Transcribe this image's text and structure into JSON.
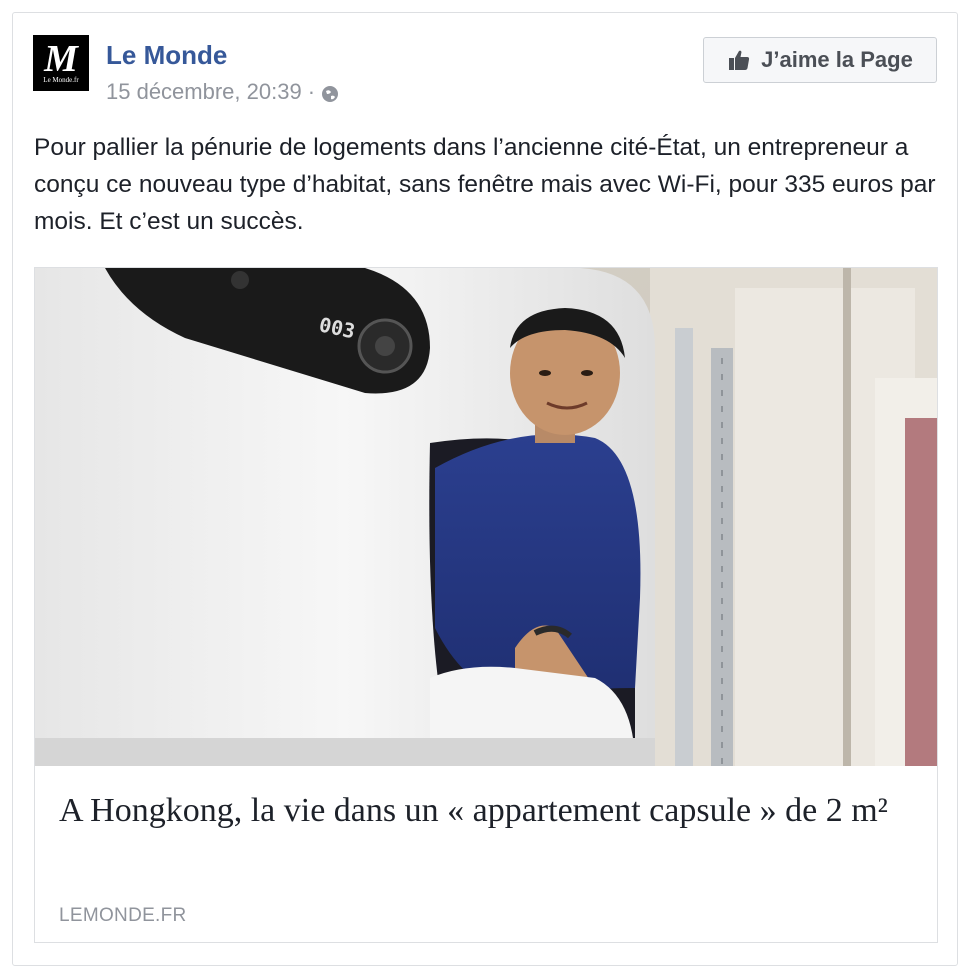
{
  "post": {
    "page_name": "Le Monde",
    "timestamp": "15 décembre, 20:39",
    "separator": "·",
    "privacy_icon": "globe-icon",
    "like_page_label": "J’aime la Page",
    "like_icon": "thumbs-up-icon",
    "text": "Pour pallier la pénurie de logements dans l’ancienne cité-État, un entrepreneur a conçu ce nouveau type d’habitat, sans fenêtre mais avec Wi-Fi, pour 335 euros par mois. Et c’est un succès."
  },
  "logo": {
    "letter": "M",
    "subtitle": "Le Monde.fr"
  },
  "capsule_label": "003",
  "link": {
    "headline": "A Hongkong, la vie dans un « appartement capsule » de 2 m²",
    "domain": "LEMONDE.FR"
  },
  "colors": {
    "link_blue": "#365899",
    "meta_gray": "#90949c",
    "text": "#1d2129",
    "border": "#dddfe2"
  }
}
